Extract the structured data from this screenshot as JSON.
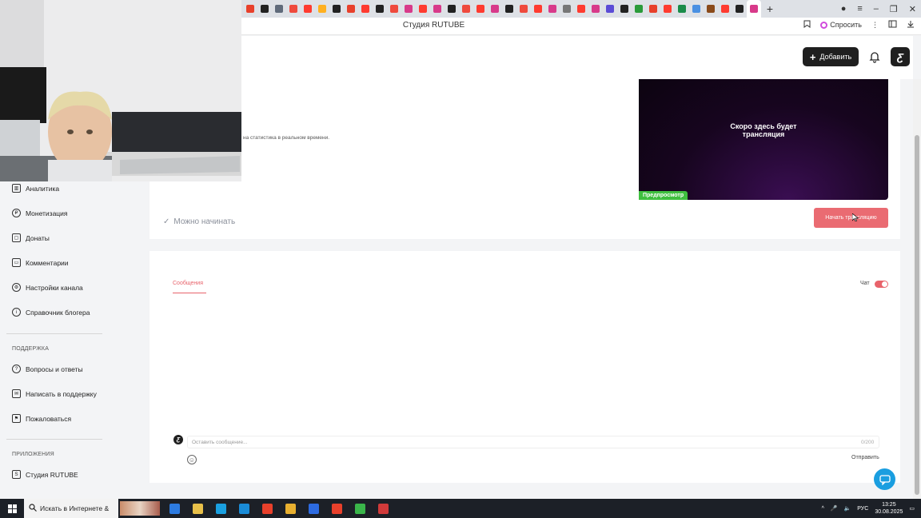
{
  "browser": {
    "page_title": "Студия RUTUBE",
    "ask_label": "Спросить",
    "tab_favicons": [
      "#e8402b",
      "#222",
      "#5f6a7a",
      "#ef4a3d",
      "#ff3b30",
      "#ffb020",
      "#222",
      "#e8402b",
      "#ff3b30",
      "#222",
      "#ef4a3d",
      "#d83a8a",
      "#ff3b30",
      "#d83a8a",
      "#222",
      "#ef4a3d",
      "#ff3b30",
      "#d83a8a",
      "#222",
      "#ef4a3d",
      "#ff3b30",
      "#d83a8a",
      "#777",
      "#ff3b30",
      "#d83a8a",
      "#5b4bd6",
      "#222",
      "#2a9b3a",
      "#e8402b",
      "#ff3b30",
      "#1a8c4a",
      "#4a90e2",
      "#8a4a1a",
      "#ff3b30",
      "#222",
      "#d83a8a"
    ],
    "new_tab_symbol": "+"
  },
  "header": {
    "add_label": "Добавить",
    "logo_letter": "Ƹ"
  },
  "sidebar": {
    "items": [
      {
        "label": "Аналитика",
        "icon": "chart-icon"
      },
      {
        "label": "Монетизация",
        "icon": "ruble-icon"
      },
      {
        "label": "Донаты",
        "icon": "donate-icon"
      },
      {
        "label": "Комментарии",
        "icon": "comment-icon"
      },
      {
        "label": "Настройки канала",
        "icon": "gear-icon"
      },
      {
        "label": "Справочник блогера",
        "icon": "info-icon"
      }
    ],
    "support_title": "ПОДДЕРЖКА",
    "support_items": [
      {
        "label": "Вопросы и ответы",
        "icon": "question-icon"
      },
      {
        "label": "Написать в поддержку",
        "icon": "mail-icon"
      },
      {
        "label": "Пожаловаться",
        "icon": "flag-icon"
      }
    ],
    "apps_title": "ПРИЛОЖЕНИЯ",
    "apps_items": [
      {
        "label": "Студия RUTUBE",
        "icon": "studio-icon"
      }
    ]
  },
  "stream": {
    "stats_text": "на статистика в реальном времени.",
    "preview_text_line1": "Скоро здесь будет",
    "preview_text_line2": "трансляция",
    "preview_badge": "Предпросмотр",
    "ready_text": "Можно начинать",
    "start_button": "Начать трансляцию"
  },
  "chat": {
    "tab_messages": "Сообщения",
    "chat_toggle_label": "Чат",
    "chat_enabled": true,
    "input_placeholder": "Оставить сообщение...",
    "char_count": "0/200",
    "send_label": "Отправить"
  },
  "taskbar": {
    "search_text": "Искать в Интернете &",
    "lang": "РУС",
    "time": "13:25",
    "date": "30.08.2025",
    "app_icons": [
      "#2d7be0",
      "#e8c04a",
      "#1aa0e0",
      "#1a8cd8",
      "#e8402b",
      "#e8b030",
      "#2d6be0",
      "#e8402b",
      "#3ab54a",
      "#d03a3a"
    ]
  },
  "colors": {
    "accent": "#e8636b",
    "start_button": "#ea6b72",
    "badge_green": "#3fbf3f",
    "help_blue": "#1a9ee0"
  }
}
